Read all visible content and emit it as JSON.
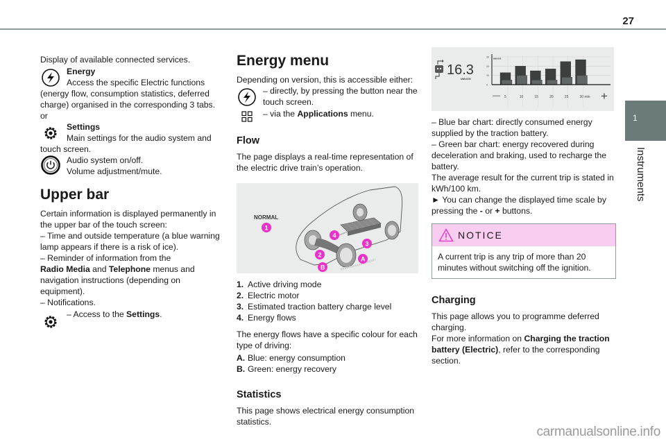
{
  "header": {
    "page_number": "27"
  },
  "side_tab": {
    "number": "1",
    "label": "Instruments"
  },
  "col1": {
    "intro": "Display of available connected services.",
    "energy": {
      "title": "Energy",
      "desc_first": "Access the specific Electric functions",
      "desc_rest": "(energy flow, consumption statistics, deferred charge) organised in the corresponding 3 tabs."
    },
    "or": "or",
    "settings": {
      "title": "Settings",
      "desc_first": "Main settings for the audio system and",
      "desc_rest": "touch screen."
    },
    "audio": {
      "line1": "Audio system on/off.",
      "line2": "Volume adjustment/mute."
    },
    "upper_bar": {
      "title": "Upper bar",
      "intro": "Certain information is displayed permanently in the upper bar of the touch screen:",
      "item1": "– Time and outside temperature (a blue warning lamp appears if there is a risk of ice).",
      "item2_a": "– Reminder of information from the",
      "item2_b1": "Radio Media",
      "item2_b2": " and ",
      "item2_b3": "Telephone",
      "item2_b4": " menus and navigation instructions (depending on equipment).",
      "item3": "– Notifications.",
      "settings_a": "– Access to the ",
      "settings_b": "Settings",
      "settings_c": "."
    }
  },
  "col2": {
    "title": "Energy menu",
    "intro": "Depending on version, this is accessible either:",
    "direct": "– directly, by pressing the button near the touch screen.",
    "via_a": "– via the ",
    "via_b": "Applications",
    "via_c": " menu.",
    "flow": {
      "title": "Flow",
      "desc": "The page displays a real-time representation of the electric drive train’s operation.",
      "figure": {
        "mode_label": "NORMAL",
        "callouts": [
          "1",
          "2",
          "3",
          "4",
          "A",
          "B"
        ]
      },
      "legend": [
        {
          "num": "1.",
          "text": "Active driving mode"
        },
        {
          "num": "2.",
          "text": "Electric motor"
        },
        {
          "num": "3.",
          "text": "Estimated traction battery charge level"
        },
        {
          "num": "4.",
          "text": "Energy flows"
        }
      ],
      "colours_intro": "The energy flows have a specific colour for each type of driving:",
      "colours": [
        {
          "num": "A.",
          "text": "Blue: energy consumption"
        },
        {
          "num": "B.",
          "text": "Green: energy recovery"
        }
      ]
    },
    "statistics": {
      "title": "Statistics",
      "desc": "This page shows electrical energy consumption statistics."
    }
  },
  "col3": {
    "chart_screen": {
      "value": "16.3",
      "unit": "kWh/100",
      "minus_label": "—",
      "plus_label": "+"
    },
    "blue_desc": "– Blue bar chart: directly consumed energy supplied by the traction battery.",
    "green_desc": "– Green bar chart: energy recovered during deceleration and braking, used to recharge the battery.",
    "avg_desc": "The average result for the current trip is stated in kWh/100 km.",
    "scale_a": "► You can change the displayed time scale by pressing the ",
    "scale_b": "-",
    "scale_c": " or ",
    "scale_d": "+",
    "scale_e": " buttons.",
    "notice": {
      "title": "NOTICE",
      "body": "A current trip is any trip of more than 20 minutes without switching off the ignition."
    },
    "charging": {
      "title": "Charging",
      "desc": "This page allows you to programme deferred charging.",
      "more_a": "For more information on ",
      "more_b": "Charging the traction battery (Electric)",
      "more_c": ", refer to the corresponding section."
    }
  },
  "chart_data": {
    "type": "bar",
    "title": "",
    "ylabel": "kWh/100",
    "xlabel": "min",
    "categories": [
      "5",
      "10",
      "15",
      "20",
      "25",
      "30 min"
    ],
    "ylim": [
      0,
      30
    ],
    "yticks": [
      "0",
      "10",
      "20",
      "30"
    ],
    "series": [
      {
        "name": "Directly consumed energy",
        "values": [
          13,
          20,
          15,
          17,
          25,
          27
        ]
      },
      {
        "name": "Energy recovered",
        "values": [
          5,
          10,
          5,
          5,
          8,
          10
        ]
      }
    ],
    "grid": true,
    "legend": "none"
  },
  "watermark": "carmanualsonline.info"
}
